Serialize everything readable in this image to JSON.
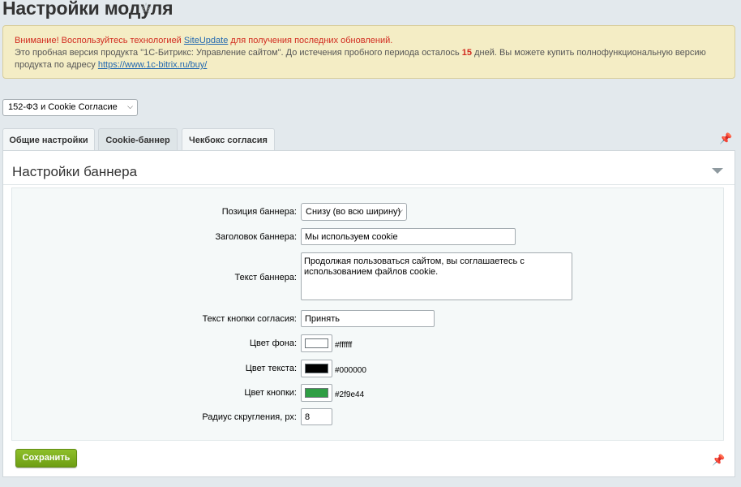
{
  "page": {
    "title": "Настройки модуля",
    "star_icon": "star-icon"
  },
  "notice": {
    "warning_text": "Внимание! Воспользуйтесь технологией ",
    "warning_link": "SiteUpdate",
    "warning_text_after": " для получения последних обновлений.",
    "trial_text_before": "Это пробная версия продукта \"1С-Битрикс: Управление сайтом\". До истечения пробного периода осталось ",
    "trial_days": "15",
    "trial_text_after": " дней. Вы можете купить полнофункциональную версию продукта по адресу ",
    "buy_link": "https://www.1c-bitrix.ru/buy/"
  },
  "module_select": {
    "value": "152-ФЗ и Cookie Согласие"
  },
  "tabs": [
    {
      "label": "Общие настройки"
    },
    {
      "label": "Cookie-баннер"
    },
    {
      "label": "Чекбокс согласия"
    }
  ],
  "panel": {
    "title": "Настройки баннера"
  },
  "form": {
    "position_label": "Позиция баннера:",
    "position_value": "Снизу (во всю ширину)",
    "heading_label": "Заголовок баннера:",
    "heading_value": "Мы используем cookie",
    "text_label": "Текст баннера:",
    "text_value": "Продолжая пользоваться сайтом, вы соглашаетесь с использованием файлов cookie.",
    "button_text_label": "Текст кнопки согласия:",
    "button_text_value": "Принять",
    "bg_color_label": "Цвет фона:",
    "bg_color_value": "#ffffff",
    "text_color_label": "Цвет текста:",
    "text_color_value": "#000000",
    "button_color_label": "Цвет кнопки:",
    "button_color_value": "#2f9e44",
    "radius_label": "Радиус скругления, px:",
    "radius_value": "8"
  },
  "actions": {
    "save_label": "Сохранить"
  },
  "colors": {
    "accent_green": "#6e9e14",
    "warning_red": "#d12a1e",
    "link_blue": "#2067b0"
  }
}
